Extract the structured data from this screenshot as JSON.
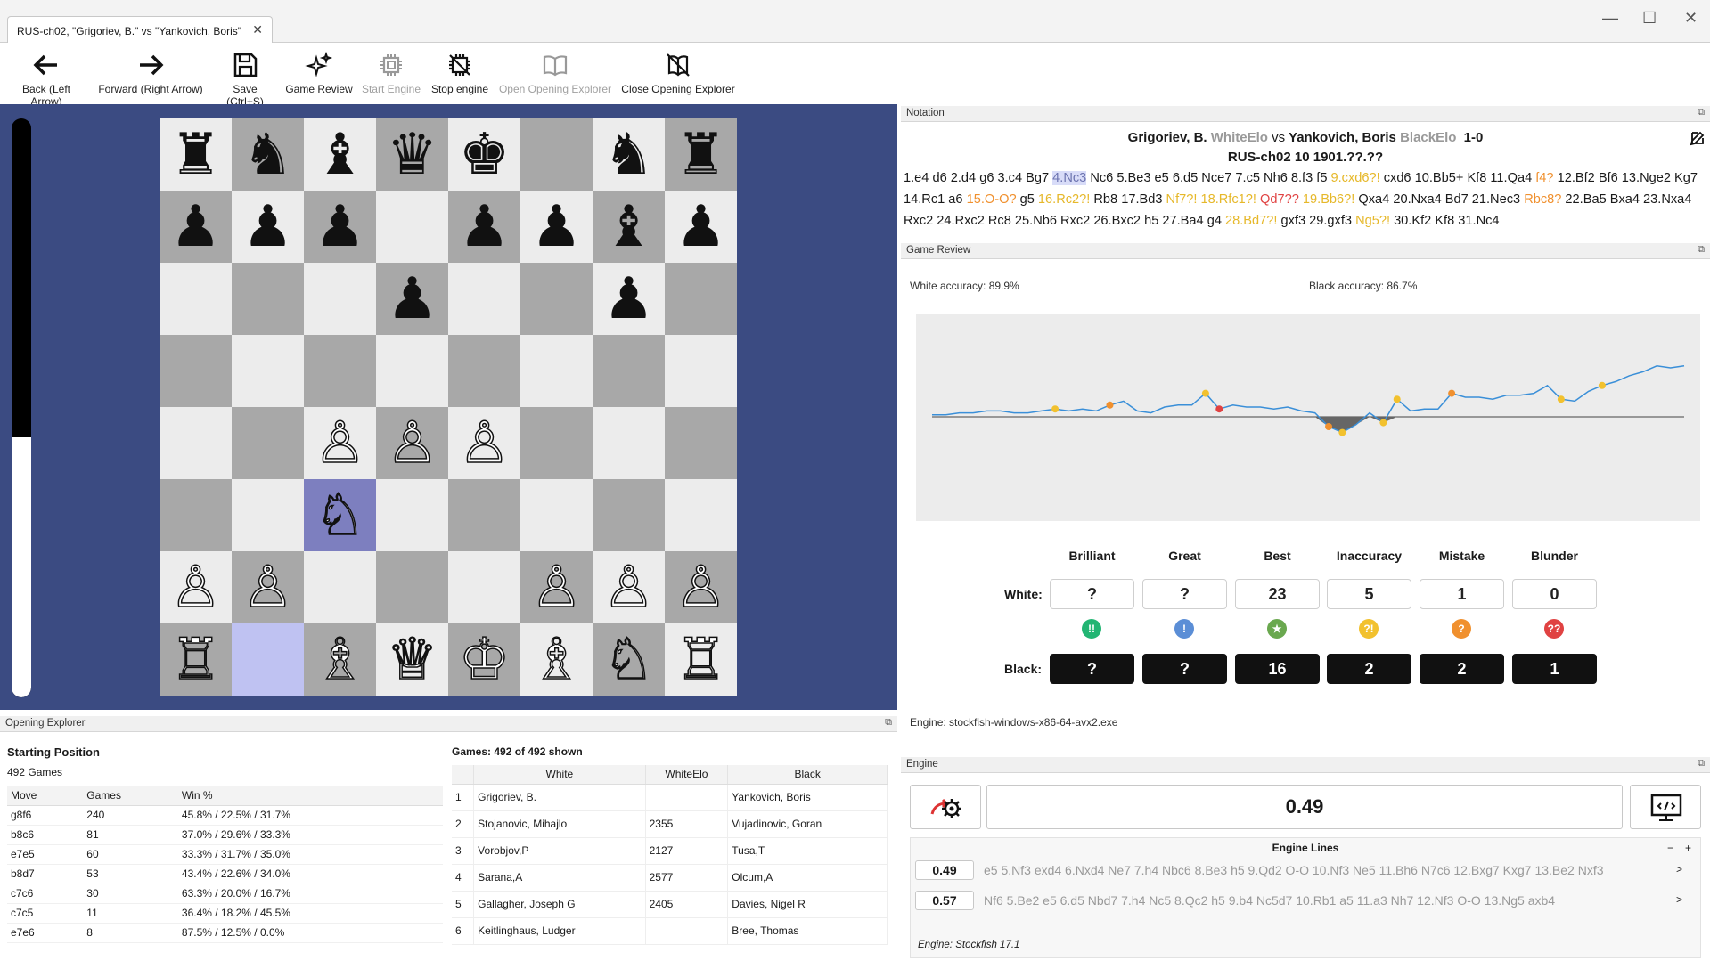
{
  "tab": {
    "title": "RUS-ch02,  \"Grigoriev, B.\" vs \"Yankovich, Boris\"",
    "close": "✕"
  },
  "window": {
    "minimize": "—",
    "maximize": "☐",
    "close": "✕"
  },
  "toolbar": {
    "back": "Back (Left Arrow)",
    "forward": "Forward (Right Arrow)",
    "save": "Save (Ctrl+S)",
    "review": "Game Review",
    "start_engine": "Start Engine",
    "stop_engine": "Stop engine",
    "open_explorer": "Open Opening Explorer",
    "close_explorer": "Close Opening Explorer"
  },
  "eval_bar": {
    "white_fraction": 0.45
  },
  "board": {
    "ranks": [
      [
        "♜",
        "♞",
        "♝",
        "♛",
        "♚",
        "",
        "♞",
        "♜"
      ],
      [
        "♟",
        "♟",
        "♟",
        "",
        "♟",
        "♟",
        "♝",
        "♟"
      ],
      [
        "",
        "",
        "",
        "♟",
        "",
        "",
        "♟",
        ""
      ],
      [
        "",
        "",
        "",
        "",
        "",
        "",
        "",
        ""
      ],
      [
        "",
        "",
        "♙",
        "♙",
        "♙",
        "",
        "",
        ""
      ],
      [
        "",
        "",
        "♘",
        "",
        "",
        "",
        "",
        ""
      ],
      [
        "♙",
        "♙",
        "",
        "",
        "",
        "♙",
        "♙",
        "♙"
      ],
      [
        "♖",
        "",
        "♗",
        "♕",
        "♔",
        "♗",
        "♘",
        "♖"
      ]
    ],
    "last_move_from": "b1",
    "last_move_to": "c3"
  },
  "notation": {
    "header": "Notation",
    "white": "Grigoriev, B.",
    "white_elo": "WhiteElo",
    "vs": "vs",
    "black": "Yankovich, Boris",
    "black_elo": "BlackElo",
    "result": "1-0",
    "event_line": "RUS-ch02  10  1901.??.??",
    "moves": [
      {
        "t": "1.e4 d6 2.d4 g6 3.c4 Bg7 ",
        "c": ""
      },
      {
        "t": "4.Nc3",
        "c": "sel"
      },
      {
        "t": " Nc6 5.Be3 e5 6.d5 Nce7 7.c5 Nh6 8.f3 f5 ",
        "c": ""
      },
      {
        "t": "9.cxd6?!",
        "c": "inacc"
      },
      {
        "t": " cxd6 10.Bb5+ Kf8 11.Qa4 ",
        "c": ""
      },
      {
        "t": "f4?",
        "c": "mist"
      },
      {
        "t": " 12.Bf2 Bf6 13.Nge2 Kg7 14.Rc1 a6 ",
        "c": ""
      },
      {
        "t": "15.O-O?",
        "c": "mist"
      },
      {
        "t": " g5 ",
        "c": ""
      },
      {
        "t": "16.Rc2?!",
        "c": "inacc"
      },
      {
        "t": " Rb8 17.Bd3 ",
        "c": ""
      },
      {
        "t": "Nf7?!",
        "c": "inacc"
      },
      {
        "t": " ",
        "c": ""
      },
      {
        "t": "18.Rfc1?!",
        "c": "inacc"
      },
      {
        "t": " ",
        "c": ""
      },
      {
        "t": "Qd7??",
        "c": "blund"
      },
      {
        "t": " ",
        "c": ""
      },
      {
        "t": "19.Bb6?!",
        "c": "inacc"
      },
      {
        "t": " Qxa4 20.Nxa4 Bd7 21.Nec3 ",
        "c": ""
      },
      {
        "t": "Rbc8?",
        "c": "mist"
      },
      {
        "t": " 22.Ba5 Bxa4 23.Nxa4 Rxc2 24.Rxc2 Rc8 25.Nb6 Rxc2 26.Bxc2 h5 27.Ba4 g4 ",
        "c": ""
      },
      {
        "t": "28.Bd7?!",
        "c": "inacc"
      },
      {
        "t": " gxf3 29.gxf3 ",
        "c": ""
      },
      {
        "t": "Ng5?!",
        "c": "inacc"
      },
      {
        "t": " 30.Kf2 Kf8 31.Nc4",
        "c": ""
      }
    ]
  },
  "review": {
    "header": "Game Review",
    "white_accuracy": "White accuracy: 89.9%",
    "black_accuracy": "Black accuracy: 86.7%",
    "eval_series": [
      0.1,
      0.1,
      0.2,
      0.2,
      0.3,
      0.3,
      0.2,
      0.2,
      0.3,
      0.4,
      0.3,
      0.4,
      0.3,
      0.6,
      0.8,
      0.3,
      0.2,
      0.5,
      0.6,
      0.6,
      1.2,
      0.4,
      0.6,
      0.5,
      0.5,
      0.4,
      0.5,
      0.3,
      0.2,
      -0.5,
      -0.8,
      -0.4,
      0.2,
      -0.3,
      0.9,
      0.3,
      0.4,
      0.4,
      1.2,
      1.0,
      1.0,
      0.9,
      1.1,
      1.1,
      1.2,
      1.6,
      0.9,
      0.8,
      1.3,
      1.6,
      1.8,
      2.1,
      2.3,
      2.6,
      2.5,
      2.6
    ],
    "classes": [
      "Brilliant",
      "Great",
      "Best",
      "Inaccuracy",
      "Mistake",
      "Blunder"
    ],
    "white_label": "White:",
    "black_label": "Black:",
    "white_counts": [
      "?",
      "?",
      "23",
      "5",
      "1",
      "0"
    ],
    "black_counts": [
      "?",
      "?",
      "16",
      "2",
      "2",
      "1"
    ],
    "badges": [
      {
        "sym": "!!",
        "color": "#22b573"
      },
      {
        "sym": "!",
        "color": "#5b8ed6"
      },
      {
        "sym": "★",
        "color": "#6aa84f"
      },
      {
        "sym": "?!",
        "color": "#f2c12e"
      },
      {
        "sym": "?",
        "color": "#f0902e"
      },
      {
        "sym": "??",
        "color": "#e04242"
      }
    ],
    "engine": "Engine: stockfish-windows-x86-64-avx2.exe"
  },
  "engine": {
    "header": "Engine",
    "eval": "0.49",
    "lines_title": "Engine Lines",
    "minus": "−",
    "plus": "+",
    "lines": [
      {
        "score": "0.49",
        "pv": "e5 5.Nf3 exd4 6.Nxd4 Ne7 7.h4 Nbc6 8.Be3 h5 9.Qd2 O-O 10.Nf3 Ne5 11.Bh6 N7c6 12.Bxg7 Kxg7 13.Be2 Nxf3",
        "arrow": ">"
      },
      {
        "score": "0.57",
        "pv": "Nf6 5.Be2 e5 6.d5 Nbd7 7.h4 Nc5 8.Qc2 h5 9.b4 Nc5d7 10.Rb1 a5 11.a3 Nh7 12.Nf3 O-O 13.Ng5 axb4",
        "arrow": ">"
      }
    ],
    "name": "Engine: Stockfish 17.1"
  },
  "opening": {
    "header": "Opening Explorer",
    "position": "Starting Position",
    "games": "492 Games",
    "columns": [
      "Move",
      "Games",
      "Win %"
    ],
    "rows": [
      [
        "g8f6",
        "240",
        "45.8% / 22.5% / 31.7%"
      ],
      [
        "b8c6",
        "81",
        "37.0% / 29.6% / 33.3%"
      ],
      [
        "e7e5",
        "60",
        "33.3% / 31.7% / 35.0%"
      ],
      [
        "b8d7",
        "53",
        "43.4% / 22.6% / 34.0%"
      ],
      [
        "c7c6",
        "30",
        "63.3% / 20.0% / 16.7%"
      ],
      [
        "c7c5",
        "11",
        "36.4% / 18.2% / 45.5%"
      ],
      [
        "e7e6",
        "8",
        "87.5% / 12.5% / 0.0%"
      ]
    ],
    "games_shown": "Games: 492 of 492 shown",
    "game_columns": [
      "",
      "White",
      "WhiteElo",
      "Black"
    ],
    "game_rows": [
      [
        "1",
        "Grigoriev, B.",
        "",
        "Yankovich, Boris"
      ],
      [
        "2",
        "Stojanovic, Mihajlo",
        "2355",
        "Vujadinovic, Goran"
      ],
      [
        "3",
        "Vorobjov,P",
        "2127",
        "Tusa,T"
      ],
      [
        "4",
        "Sarana,A",
        "2577",
        "Olcum,A"
      ],
      [
        "5",
        "Gallagher, Joseph G",
        "2405",
        "Davies, Nigel R"
      ],
      [
        "6",
        "Keitlinghaus, Ludger",
        "",
        "Bree, Thomas"
      ]
    ]
  }
}
